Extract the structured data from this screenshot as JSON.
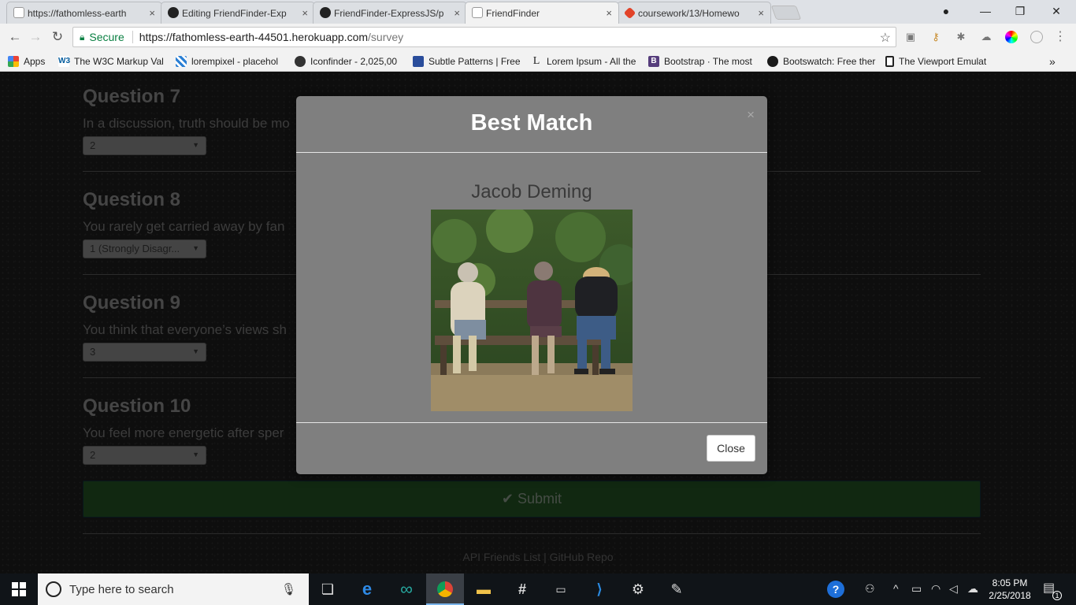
{
  "tabs": [
    {
      "title": "https://fathomless-earth",
      "favicon": "page-icon",
      "active": false
    },
    {
      "title": "Editing FriendFinder-Exp",
      "favicon": "github-icon",
      "active": false
    },
    {
      "title": "FriendFinder-ExpressJS/p",
      "favicon": "github-icon",
      "active": false
    },
    {
      "title": "FriendFinder",
      "favicon": "page-icon",
      "active": true
    },
    {
      "title": "coursework/13/Homewo",
      "favicon": "gitlab-icon",
      "active": false
    }
  ],
  "tab_close_glyph": "×",
  "address": {
    "secure_label": "Secure",
    "url_host": "https://fathomless-earth-44501.herokuapp.com",
    "url_path": "/survey"
  },
  "bookmarks": [
    {
      "label": "Apps",
      "icon": "apps-grid-icon"
    },
    {
      "label": "The W3C Markup Val",
      "icon": "w3c-icon"
    },
    {
      "label": "lorempixel - placehol",
      "icon": "lorempixel-icon"
    },
    {
      "label": "Iconfinder - 2,025,00",
      "icon": "iconfinder-icon"
    },
    {
      "label": "Subtle Patterns | Free",
      "icon": "subtle-patterns-icon"
    },
    {
      "label": "Lorem Ipsum - All the",
      "icon": "lorem-ipsum-icon"
    },
    {
      "label": "Bootstrap · The most",
      "icon": "bootstrap-icon"
    },
    {
      "label": "Bootswatch: Free ther",
      "icon": "bootswatch-icon"
    },
    {
      "label": "The Viewport Emulat",
      "icon": "viewport-icon"
    }
  ],
  "bookmarks_overflow": "»",
  "questions": [
    {
      "title": "Question 7",
      "text": "In a discussion, truth should be mo",
      "selected": "2"
    },
    {
      "title": "Question 8",
      "text": "You rarely get carried away by fan",
      "selected": "1 (Strongly Disagr..."
    },
    {
      "title": "Question 9",
      "text": "You think that everyone’s views sh",
      "selected": "3"
    },
    {
      "title": "Question 10",
      "text": "You feel more energetic after sper",
      "selected": "2"
    }
  ],
  "submit_label": "Submit",
  "footer": {
    "api_link": "API Friends List",
    "separator": "|",
    "repo_link": "GitHub Repo"
  },
  "modal": {
    "title": "Best Match",
    "close_x": "×",
    "match_name": "Jacob Deming",
    "close_button": "Close"
  },
  "taskbar": {
    "search_placeholder": "Type here to search",
    "time": "8:05 PM",
    "date": "2/25/2018",
    "notification_count": "1"
  },
  "colors": {
    "secure_green": "#0b8043",
    "submit_green": "#1f4a1f",
    "modal_bg": "#7f7f7f"
  }
}
